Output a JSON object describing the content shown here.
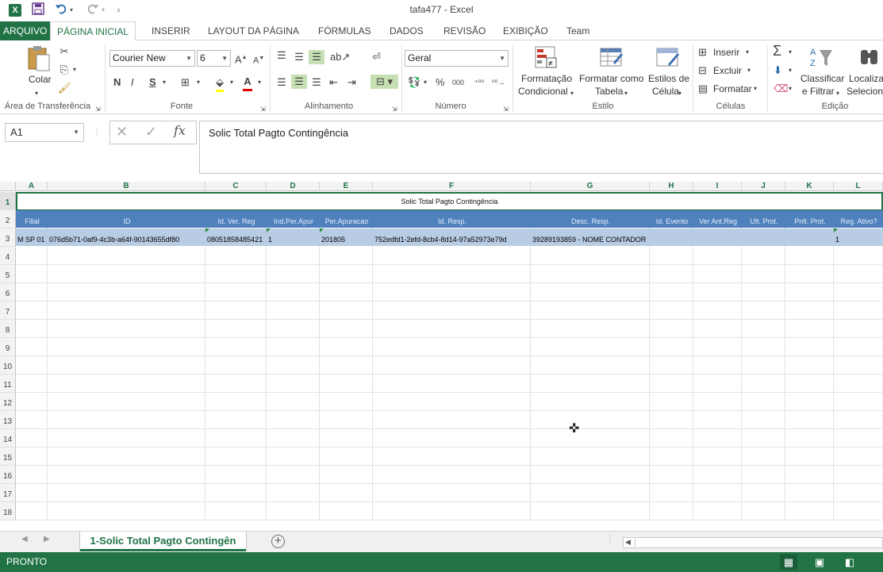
{
  "window": {
    "title": "tafa477 - Excel"
  },
  "quick_access": {
    "save_icon": "save-icon",
    "undo_icon": "undo-icon",
    "redo_icon": "redo-icon",
    "customize_icon": "customize-icon"
  },
  "tabs": [
    {
      "label": "ARQUIVO"
    },
    {
      "label": "PÁGINA INICIAL"
    },
    {
      "label": "INSERIR"
    },
    {
      "label": "LAYOUT DA PÁGINA"
    },
    {
      "label": "FÓRMULAS"
    },
    {
      "label": "DADOS"
    },
    {
      "label": "REVISÃO"
    },
    {
      "label": "EXIBIÇÃO"
    },
    {
      "label": "Team"
    }
  ],
  "ribbon": {
    "clipboard": {
      "paste_label": "Colar",
      "group_label": "Área de Transferência"
    },
    "font": {
      "family": "Courier New",
      "size": "6",
      "bold": "N",
      "italic": "I",
      "underline": "S",
      "group_label": "Fonte"
    },
    "alignment": {
      "group_label": "Alinhamento"
    },
    "number": {
      "format": "Geral",
      "percent": "%",
      "thousands": "000",
      "group_label": "Número"
    },
    "styles": {
      "conditional_line1": "Formatação",
      "conditional_line2": "Condicional",
      "table_line1": "Formatar como",
      "table_line2": "Tabela",
      "cell_line1": "Estilos de",
      "cell_line2": "Célula",
      "group_label": "Estilo"
    },
    "cells": {
      "insert": "Inserir",
      "delete": "Excluir",
      "format": "Formatar",
      "group_label": "Células"
    },
    "editing": {
      "sort_line1": "Classificar",
      "sort_line2": "e Filtrar",
      "find_line1": "Localiza",
      "find_line2": "Seleciona",
      "group_label": "Edição"
    }
  },
  "formula_bar": {
    "name_box": "A1",
    "fx": "fx",
    "content": "Solic Total Pagto Contingência"
  },
  "columns": [
    "A",
    "B",
    "C",
    "D",
    "E",
    "F",
    "G",
    "H",
    "I",
    "J",
    "K",
    "L"
  ],
  "rows": [
    "1",
    "2",
    "3",
    "4",
    "5",
    "6",
    "7",
    "8",
    "9",
    "10",
    "11",
    "12",
    "13",
    "14",
    "15",
    "16",
    "17",
    "18"
  ],
  "sheet": {
    "title_cell": "Solic Total Pagto Contingência",
    "headers": [
      "Filial",
      "ID",
      "Id. Ver. Reg",
      "Ind.Per.Apur",
      "Per.Apuracao",
      "Id. Resp.",
      "Desc. Resp.",
      "Id. Evento",
      "Ver Ant.Reg",
      "Ult. Prot.",
      "Pnlt. Prot.",
      "Reg. Ativo?"
    ],
    "row3": [
      "M SP 01",
      "076d5b71-0af9-4c3b-a64f-90143655df80",
      "08051858485421",
      "1",
      "201805",
      "752edfd1-2efd-8cb4-8d14-97a52973e79d",
      "39289193859 - NOME CONTADOR",
      "",
      "",
      "",
      "",
      "1"
    ]
  },
  "sheet_tabs": [
    {
      "label": "1-Solic Total Pagto Contingên"
    }
  ],
  "status": {
    "text": "PRONTO"
  },
  "colors": {
    "excel_green": "#217346",
    "header_blue": "#4f81bd",
    "data_blue": "#b8cce4"
  }
}
